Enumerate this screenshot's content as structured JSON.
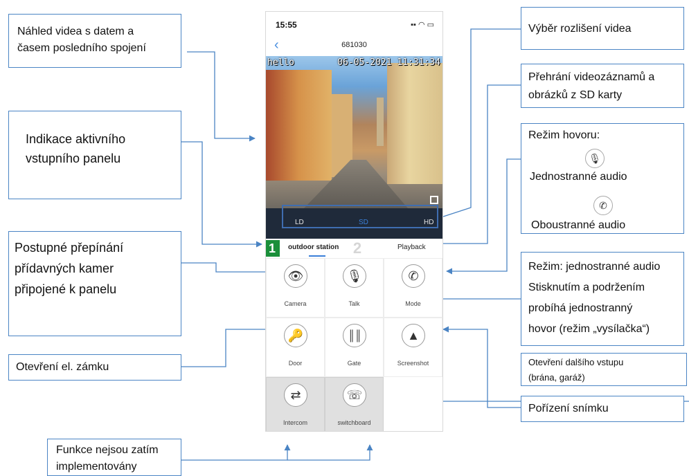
{
  "phone": {
    "status_time": "15:55",
    "status_icons": "▪▪ ◠ ▭",
    "nav_back": "‹",
    "nav_title": "681030",
    "video_osd_left": "hello",
    "video_osd_right": "06-05-2021 11:31:34",
    "resolution": [
      "LD",
      "SD",
      "HD"
    ],
    "tabs": {
      "number1": "1",
      "outdoor": "outdoor station",
      "number2": "2",
      "playback": "Playback"
    },
    "grid": [
      {
        "label": "Camera",
        "icon": "eye-icon"
      },
      {
        "label": "Talk",
        "icon": "microphone-icon"
      },
      {
        "label": "Mode",
        "icon": "phone-mic-icon"
      },
      {
        "label": "Door",
        "icon": "key-icon"
      },
      {
        "label": "Gate",
        "icon": "gate-icon"
      },
      {
        "label": "Screenshot",
        "icon": "picture-icon"
      },
      {
        "label": "Intercom",
        "icon": "intercom-icon"
      },
      {
        "label": "switchboard",
        "icon": "switchboard-icon"
      }
    ]
  },
  "callouts": {
    "preview": "Náhled videa s datem a\nčasem posledního spojení",
    "active_panel": "Indikace aktivního\nvstupního panelu",
    "cameras": "Postupné přepínání\npřídavných kamer\npřipojené k panelu",
    "lock": "Otevření el. zámku",
    "not_impl": "Funkce nejsou zatím\nimplementovány",
    "resolution": "Výběr rozlišení videa",
    "playback": "Přehrání videozáznamů a\nobrázků z SD karty",
    "call_mode_title": "Režim hovoru:",
    "one_way": "Jednostranné audio",
    "two_way": "Oboustranné audio",
    "mode_desc": "Režim: jednostranné audio\nStisknutím a podržením\nprobíhá jednostranný\nhovor (režim „vysílačka“)",
    "gate": "Otevření dalšího vstupu\n(brána, garáž)",
    "snapshot": "Pořízení snímku"
  },
  "colors": {
    "callout_border": "#4a84c4",
    "active_tab": "#1a8f3a",
    "accent": "#3a7fd8"
  }
}
